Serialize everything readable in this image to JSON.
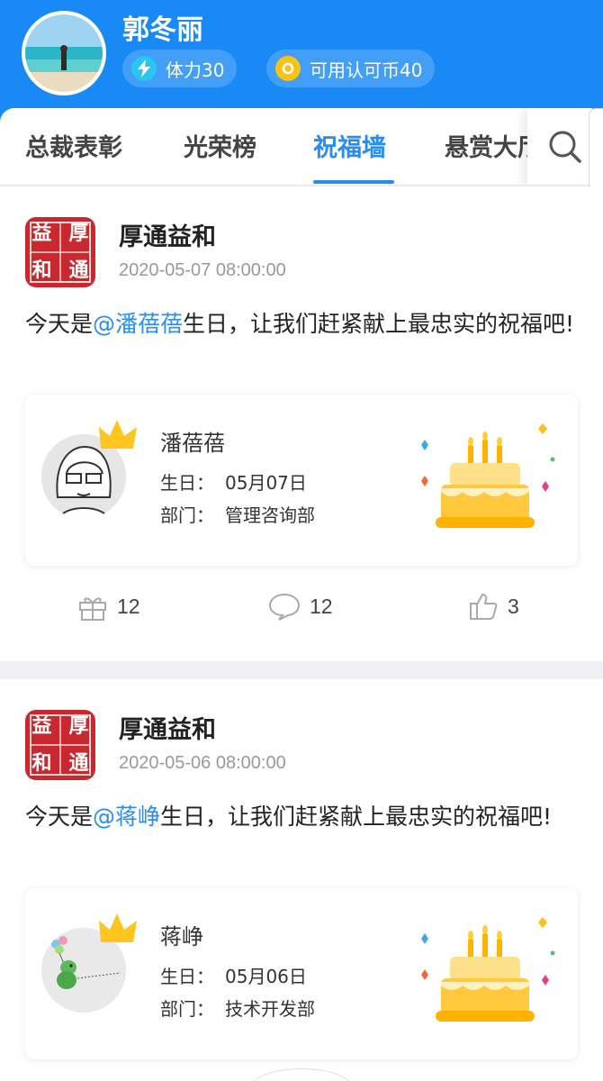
{
  "header": {
    "username": "郭冬丽",
    "energy": "体力30",
    "coins": "可用认可币40"
  },
  "tabs": [
    {
      "label": "总裁表彰"
    },
    {
      "label": "光荣榜"
    },
    {
      "label": "祝福墙",
      "active": true
    },
    {
      "label": "悬赏大厅"
    }
  ],
  "colors": {
    "brand": "#1989f5",
    "accent": "#2a8cf0",
    "seal": "#c8282e"
  },
  "posts": [
    {
      "poster": "厚通益和",
      "seal_chars": "益厚和通",
      "date": "2020-05-07 08:00:00",
      "msg_prefix": "今天是",
      "mention": "@潘蓓蓓",
      "msg_suffix": "生日，让我们赶紧献上最忠实的祝福吧!",
      "person": {
        "name": "潘蓓蓓",
        "birthday_label": "生日：",
        "birthday": "05月07日",
        "dept_label": "部门：",
        "dept": "管理咨询部"
      },
      "gifts": "12",
      "comments": "12",
      "likes": "3"
    },
    {
      "poster": "厚通益和",
      "seal_chars": "益厚和通",
      "date": "2020-05-06 08:00:00",
      "msg_prefix": "今天是",
      "mention": "@蒋峥",
      "msg_suffix": "生日，让我们赶紧献上最忠实的祝福吧!",
      "person": {
        "name": "蒋峥",
        "birthday_label": "生日：",
        "birthday": "05月06日",
        "dept_label": "部门：",
        "dept": "技术开发部"
      }
    }
  ]
}
